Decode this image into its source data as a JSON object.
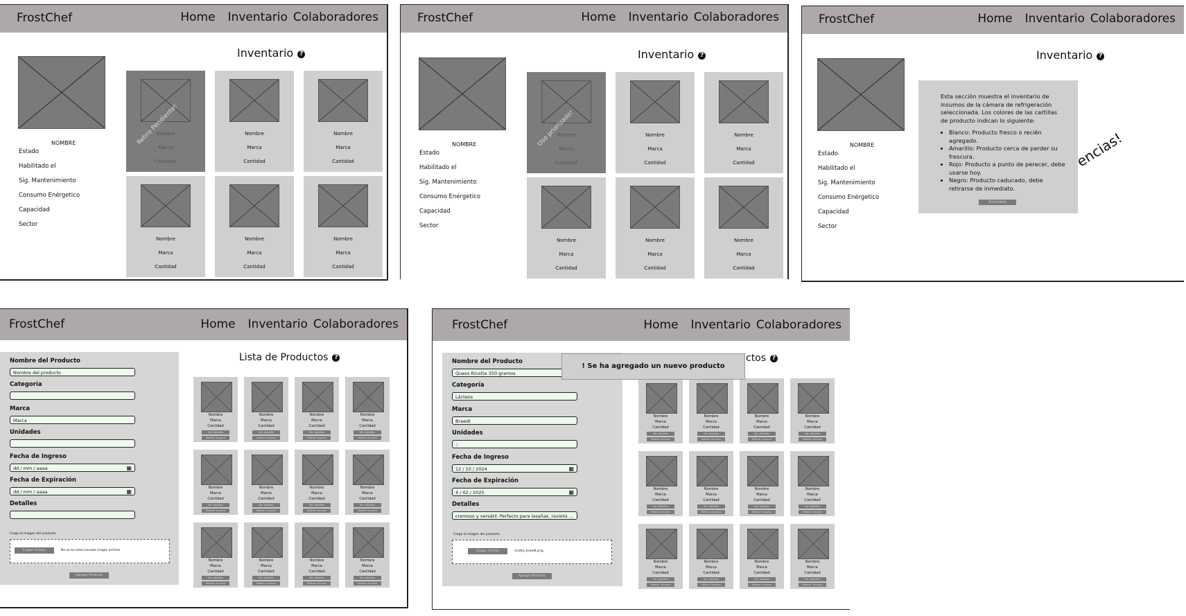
{
  "nav": {
    "brand": "FrostChef",
    "home": "Home",
    "inventario": "Inventario",
    "colaboradores": "Colaboradores"
  },
  "inventory": {
    "title": "Inventario",
    "device_name": "NOMBRE",
    "attributes": [
      "Estado",
      "Habilitado el",
      "Sig. Mantenimiento",
      "Consumo Enérgetico",
      "Capacidad",
      "Sector"
    ],
    "card": {
      "nombre": "Nombre",
      "marca": "Marca",
      "cantidad": "Cantidad"
    },
    "banner_1": "Retiro Pendiente!",
    "banner_2": "Uso priorizado!",
    "slogan_fragment": "encias!"
  },
  "info": {
    "intro": "Esta sección muestra el inventario de insumos de la cámara de refrigeración seleccionada. Los colores de las cartillas de producto indican lo siguiente:",
    "items": [
      "Blanco: Producto fresco o recién agregado.",
      "Amarillo: Producto cerca de perder su frescura.",
      "Rojo: Producto a punto de perecer, debe usarse hoy.",
      "Negro: Producto caducado, debe retirarse de inmediato."
    ],
    "button": "Entendido"
  },
  "form": {
    "labels": {
      "nombre": "Nombre del Producto",
      "categoria": "Categoría",
      "marca": "Marca",
      "unidades": "Unidades",
      "ingreso": "Fecha de Ingreso",
      "expiracion": "Fecha de Expiración",
      "detalles": "Detalles"
    },
    "empty": {
      "nombre_placeholder": "Nombre del producto",
      "marca_placeholder": "Marca",
      "ingreso": "dd / mm / aaaa",
      "expiracion": "dd / mm / aaaa"
    },
    "filled": {
      "nombre": "Queso Ricotta 350 gramos",
      "categoria": "Lácteos",
      "marca": "Braedt",
      "unidades": "2",
      "ingreso": "12 / 10 / 2024",
      "expiracion": "4 / 02 / 2025",
      "detalles": "cremoso y versátil. Perfecto para lasañas, raviolis ..."
    },
    "image_label": "Carga la imagen del producto",
    "load_button": "Cargar Archivo",
    "load_text_empty": "No se ha seleccionado ningún archivo",
    "load_text_filled": "ricotta_braedt.png",
    "add_button": "Agregar Producto"
  },
  "list": {
    "title": "Lista de Productos",
    "title_partial": "ctos",
    "card": {
      "nombre": "Nombre",
      "marca": "Marca",
      "cantidad": "Cantidad",
      "ver": "Ver detalles",
      "retirar": "Retirar insumo"
    }
  },
  "toast": {
    "text": "! Se ha agregado un nuevo producto"
  }
}
